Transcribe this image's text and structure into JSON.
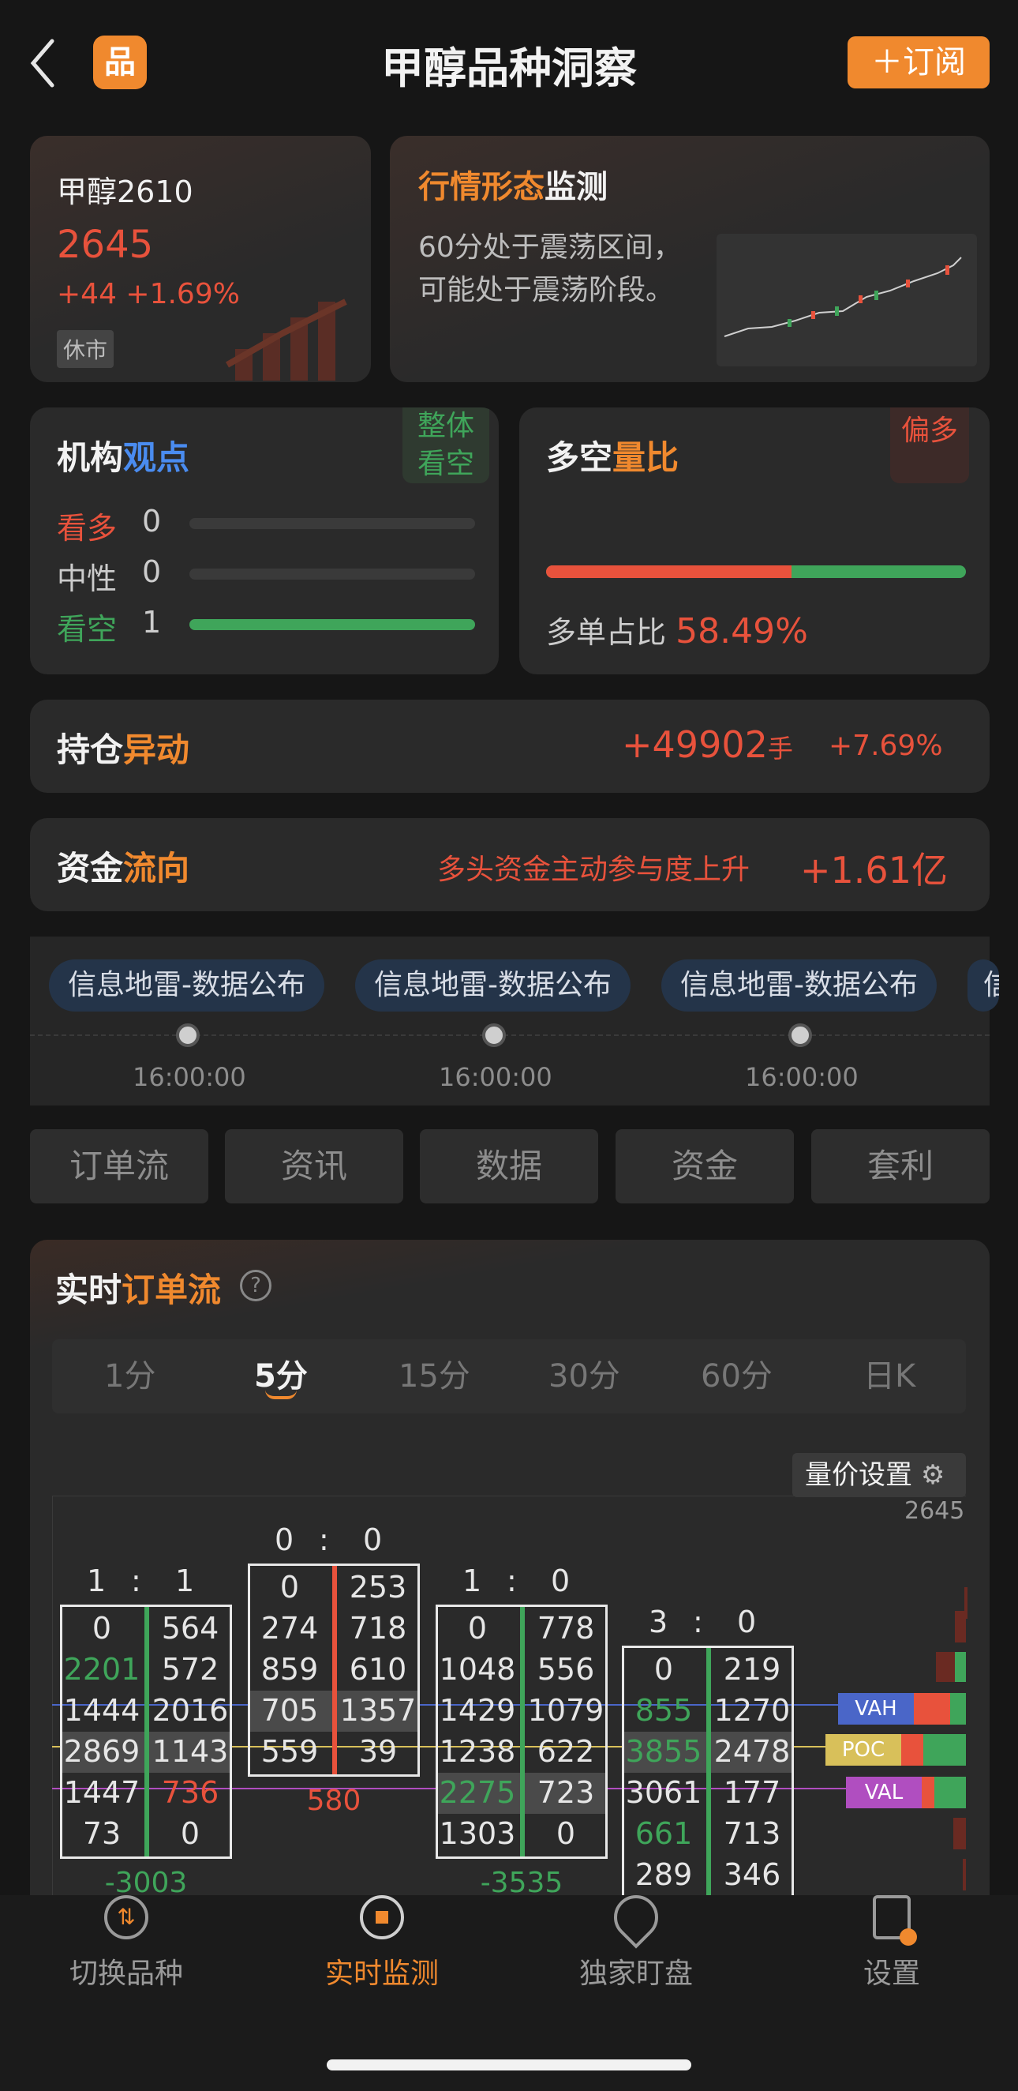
{
  "header": {
    "title": "甲醇品种洞察",
    "logo_text": "品",
    "subscribe_label": "订阅",
    "subscribe_icon": "plus-icon"
  },
  "quote": {
    "name": "甲醇2610",
    "price": "2645",
    "change": "+44 +1.69%",
    "status": "休市"
  },
  "pattern": {
    "title_a": "行情形态",
    "title_b": "监测",
    "desc_line1": "60分处于震荡区间，",
    "desc_line2": "可能处于震荡阶段。"
  },
  "institution": {
    "title_a": "机构",
    "title_b": "观点",
    "badge_line1": "整体",
    "badge_line2": "看空",
    "rows": [
      {
        "label": "看多",
        "value": "0",
        "fill": 0
      },
      {
        "label": "中性",
        "value": "0",
        "fill": 0
      },
      {
        "label": "看空",
        "value": "1",
        "fill": 1
      }
    ]
  },
  "ratio": {
    "title_a": "多空",
    "title_b": "量比",
    "badge": "偏多",
    "label": "多单占比",
    "value": "58.49%",
    "long_fraction": 0.5849
  },
  "position": {
    "title_a": "持仓",
    "title_b": "异动",
    "value": "+49902",
    "unit": "手",
    "pct": "+7.69%"
  },
  "capital": {
    "title_a": "资金",
    "title_b": "流向",
    "desc": "多头资金主动参与度上升",
    "value": "+1.61亿"
  },
  "timeline": [
    {
      "label": "信息地雷-数据公布",
      "time": "16:00:00"
    },
    {
      "label": "信息地雷-数据公布",
      "time": "16:00:00"
    },
    {
      "label": "信息地雷-数据公布",
      "time": "16:00:00"
    },
    {
      "label": "信",
      "time": ""
    }
  ],
  "tabs": [
    "订单流",
    "资讯",
    "数据",
    "资金",
    "套利"
  ],
  "orderflow": {
    "title_a": "实时",
    "title_b": "订单流",
    "help_icon": "question-icon",
    "periods": [
      "1分",
      "5分",
      "15分",
      "30分",
      "60分",
      "日K"
    ],
    "active_period": "5分",
    "settings_label": "量价设置",
    "price_label": "2645",
    "markers": [
      "VAH",
      "POC",
      "VAL"
    ],
    "bars": [
      {
        "ratio": [
          "1",
          ":",
          "1"
        ],
        "rows": [
          [
            "0",
            "564"
          ],
          [
            "2201",
            "572"
          ],
          [
            "1444",
            "2016"
          ],
          [
            "2869",
            "1143"
          ],
          [
            "1447",
            "736"
          ],
          [
            "73",
            "0"
          ]
        ],
        "delta": "-3003"
      },
      {
        "ratio": [
          "0",
          ":",
          "0"
        ],
        "rows": [
          [
            "0",
            "253"
          ],
          [
            "274",
            "718"
          ],
          [
            "859",
            "610"
          ],
          [
            "705",
            "1357"
          ],
          [
            "559",
            "39"
          ]
        ],
        "delta": "580"
      },
      {
        "ratio": [
          "1",
          ":",
          "0"
        ],
        "rows": [
          [
            "0",
            "778"
          ],
          [
            "1048",
            "556"
          ],
          [
            "1429",
            "1079"
          ],
          [
            "1238",
            "622"
          ],
          [
            "2275",
            "723"
          ],
          [
            "1303",
            "0"
          ]
        ],
        "delta": "-3535"
      },
      {
        "ratio": [
          "3",
          ":",
          "0"
        ],
        "rows": [
          [
            "0",
            "219"
          ],
          [
            "855",
            "1270"
          ],
          [
            "3855",
            "2478"
          ],
          [
            "3061",
            "177"
          ],
          [
            "661",
            "713"
          ],
          [
            "289",
            "346"
          ]
        ],
        "delta": ""
      }
    ]
  },
  "nav": [
    {
      "label": "切换品种",
      "icon": "switch-icon",
      "active": false
    },
    {
      "label": "实时监测",
      "icon": "monitor-icon",
      "active": true
    },
    {
      "label": "独家盯盘",
      "icon": "watch-icon",
      "active": false
    },
    {
      "label": "设置",
      "icon": "settings-icon",
      "active": false
    }
  ],
  "colors": {
    "accent": "#f0892e",
    "up": "#e8523c",
    "down": "#3fa55a"
  }
}
